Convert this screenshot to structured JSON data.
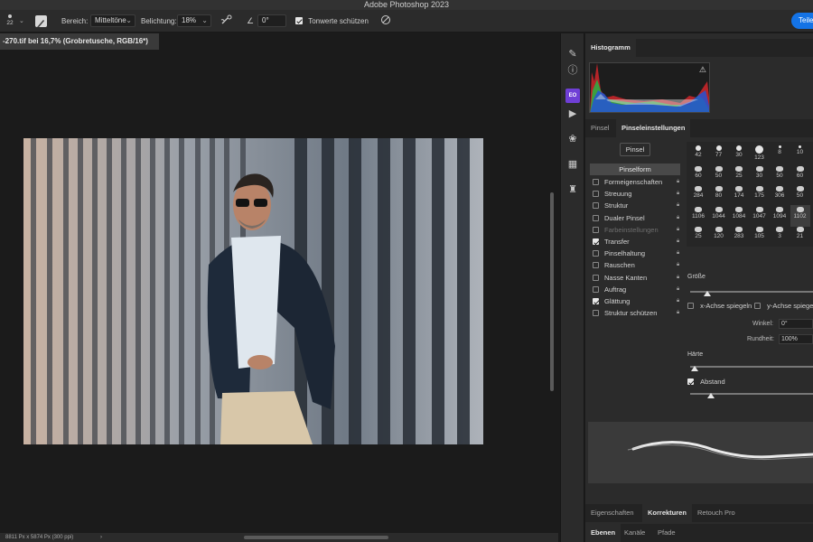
{
  "app": {
    "title": "Adobe Photoshop 2023",
    "share_label": "Teilen"
  },
  "options": {
    "brush_size": "22",
    "range_label": "Bereich:",
    "range_value": "Mitteltöne",
    "exposure_label": "Belichtung:",
    "exposure_value": "18%",
    "angle_value": "0°",
    "protect_tones_label": "Tonwerte schützen"
  },
  "document": {
    "tab_title": "-270.tif bei 16,7% (Grobretusche, RGB/16*)",
    "status": "8811 Px x 5874 Px (300 ppi)",
    "status_arrow": "›"
  },
  "histogram": {
    "tab": "Histogramm",
    "warning_icon": "warning-icon"
  },
  "brush_panel": {
    "tabs": [
      "Pinsel",
      "Pinseleinstellungen"
    ],
    "pinsel_button": "Pinsel",
    "pinselform": "Pinselform",
    "items": [
      {
        "label": "Formeigenschaften",
        "checked": false
      },
      {
        "label": "Streuung",
        "checked": false
      },
      {
        "label": "Struktur",
        "checked": false
      },
      {
        "label": "Dualer Pinsel",
        "checked": false
      },
      {
        "label": "Farbeinstellungen",
        "checked": false,
        "disabled": true
      },
      {
        "label": "Transfer",
        "checked": true
      },
      {
        "label": "Pinselhaltung",
        "checked": false
      },
      {
        "label": "Rauschen",
        "checked": false
      },
      {
        "label": "Nasse Kanten",
        "checked": false
      },
      {
        "label": "Auftrag",
        "checked": false
      },
      {
        "label": "Glättung",
        "checked": true
      },
      {
        "label": "Struktur schützen",
        "checked": false
      }
    ],
    "tips": [
      "42",
      "77",
      "30",
      "123",
      "8",
      "10",
      "60",
      "50",
      "25",
      "30",
      "50",
      "60",
      "284",
      "80",
      "174",
      "175",
      "306",
      "50",
      "1106",
      "1044",
      "1084",
      "1047",
      "1094",
      "1102",
      "25",
      "120",
      "283",
      "105",
      "3",
      "21"
    ],
    "size_label": "Größe",
    "flip_x": "x-Achse spiegeln",
    "flip_y": "y-Achse spiegeln",
    "angle_label": "Winkel:",
    "angle_value": "0°",
    "roundness_label": "Rundheit:",
    "roundness_value": "100%",
    "hardness_label": "Härte",
    "spacing_label": "Abstand"
  },
  "bottom_tabs_1": [
    "Eigenschaften",
    "Korrekturen",
    "Retouch Pro"
  ],
  "bottom_tabs_2": [
    "Ebenen",
    "Kanäle",
    "Pfade"
  ],
  "colors": {
    "accent": "#1473e6",
    "panel": "#2b2b2b",
    "canvas": "#1b1b1b"
  }
}
